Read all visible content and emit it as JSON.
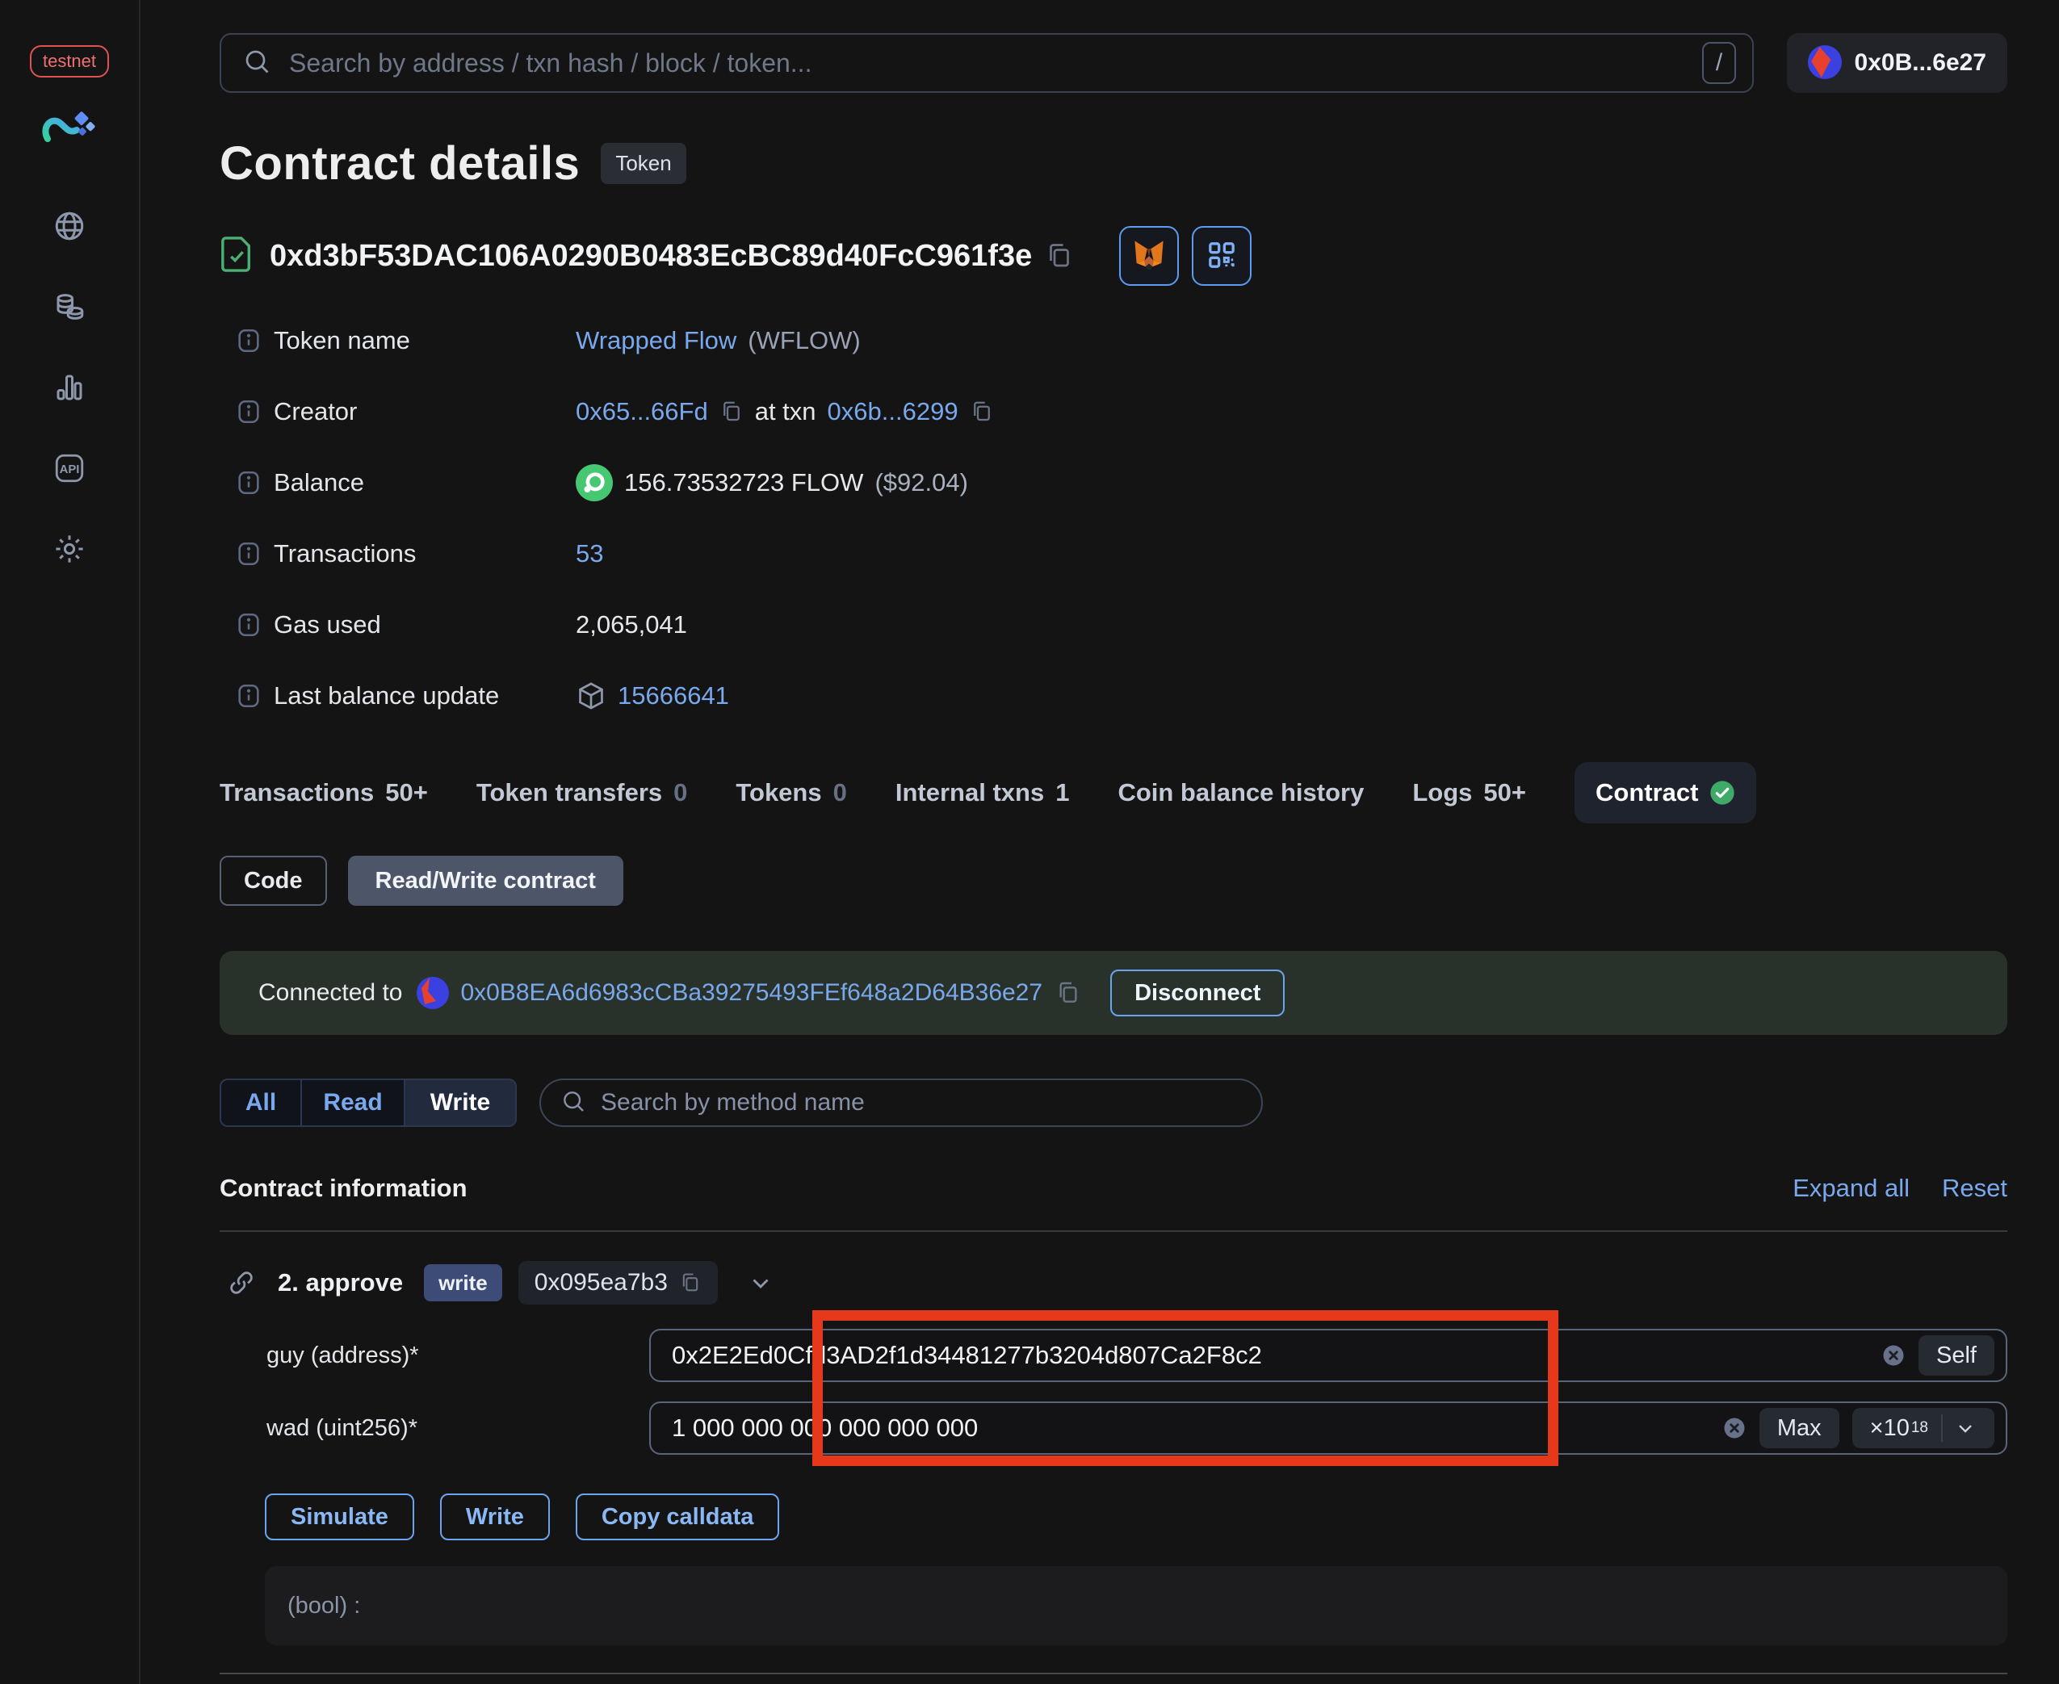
{
  "colors": {
    "accent_blue": "#79a8ec",
    "button_blue": "#6ba3f0",
    "verified_green": "#4cae74",
    "flow_green": "#46c873",
    "highlight_red": "#e6391c",
    "banner_green_bg": "#29322a",
    "testnet_red": "#ef7070"
  },
  "sidebar": {
    "badge": "testnet",
    "icons": [
      "app-logo",
      "globe-icon",
      "tokens-icon",
      "stats-icon",
      "api-icon",
      "gear-icon"
    ]
  },
  "header": {
    "search_placeholder": "Search by address / txn hash / block / token...",
    "shortcut_key": "/",
    "account_address": "0x0B...6e27"
  },
  "page": {
    "title": "Contract details",
    "type_badge": "Token",
    "address": "0xd3bF53DAC106A0290B0483EcBC89d40FcC961f3e"
  },
  "details": {
    "token_name": {
      "label": "Token name",
      "link": "Wrapped Flow",
      "suffix": "(WFLOW)"
    },
    "creator": {
      "label": "Creator",
      "address": "0x65...66Fd",
      "middle": "at txn",
      "txn": "0x6b...6299"
    },
    "balance": {
      "label": "Balance",
      "value": "156.73532723 FLOW",
      "usd": "($92.04)"
    },
    "transactions": {
      "label": "Transactions",
      "value": "53"
    },
    "gas_used": {
      "label": "Gas used",
      "value": "2,065,041"
    },
    "last_balance_update": {
      "label": "Last balance update",
      "value": "15666641"
    }
  },
  "tabs": [
    {
      "label": "Transactions",
      "count": "50+"
    },
    {
      "label": "Token transfers",
      "count": "0"
    },
    {
      "label": "Tokens",
      "count": "0"
    },
    {
      "label": "Internal txns",
      "count": "1"
    },
    {
      "label": "Coin balance history",
      "count": ""
    },
    {
      "label": "Logs",
      "count": "50+"
    },
    {
      "label": "Contract",
      "count": ""
    }
  ],
  "subtabs": {
    "code": "Code",
    "read_write": "Read/Write contract"
  },
  "connection": {
    "prefix": "Connected to",
    "address": "0x0B8EA6d6983cCBa39275493FEf648a2D64B36e27",
    "disconnect": "Disconnect"
  },
  "filter": {
    "all": "All",
    "read": "Read",
    "write": "Write",
    "selected": "Write",
    "search_placeholder": "Search by method name"
  },
  "contract_info": {
    "heading": "Contract information",
    "expand_all": "Expand all",
    "reset": "Reset"
  },
  "method": {
    "name": "2. approve",
    "badge": "write",
    "selector": "0x095ea7b3",
    "fields": [
      {
        "label": "guy (address)*",
        "value": "0x2E2Ed0Cfd3AD2f1d34481277b3204d807Ca2F8c2",
        "action": "Self"
      },
      {
        "label": "wad (uint256)*",
        "value": "1 000 000 000 000 000 000",
        "action": "Max",
        "multiplier": "×10",
        "exponent": "18"
      }
    ],
    "buttons": {
      "simulate": "Simulate",
      "write": "Write",
      "copy_calldata": "Copy calldata"
    },
    "output": "(bool) :"
  }
}
